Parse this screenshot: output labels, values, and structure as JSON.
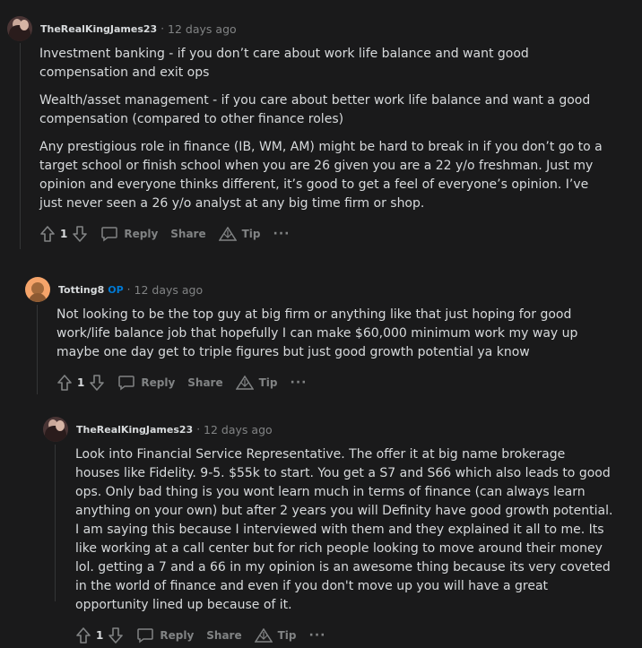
{
  "comments": [
    {
      "username": "TheRealKingJames23",
      "op_badge": "",
      "time": "12 days ago",
      "paragraphs": [
        "Investment banking - if you don’t care about work life balance and want good compensation and exit ops",
        "Wealth/asset management - if you care about better work life balance and want a good compensation (compared to other finance roles)",
        "Any prestigious role in finance (IB, WM, AM) might be hard to break in if you don’t go to a target school or finish school when you are 26 given you are a 22 y/o freshman. Just my opinion and everyone thinks different, it’s good to get a feel of everyone’s opinion. I’ve just never seen a 26 y/o analyst at any big time firm or shop."
      ],
      "votes": "1"
    },
    {
      "username": "Totting8",
      "op_badge": "OP",
      "time": "12 days ago",
      "paragraphs": [
        "Not looking to be the top guy at big firm or anything like that just hoping for good work/life balance job that hopefully I can make $60,000 minimum work my way up maybe one day get to triple figures but just good growth potential ya know"
      ],
      "votes": "1"
    },
    {
      "username": "TheRealKingJames23",
      "op_badge": "",
      "time": "12 days ago",
      "paragraphs": [
        "Look into Financial Service Representative. The offer it at big name brokerage houses like Fidelity. 9-5. $55k to start. You get a S7 and S66 which also leads to good ops. Only bad thing is you wont learn much in terms of finance (can always learn anything on your own) but after 2 years you will Definity have good growth potential. I am saying this because I interviewed with them and they explained it all to me. Its like working at a call center but for rich people looking to move around their money lol. getting a 7 and a 66 in my opinion is an awesome thing because its very coveted in the world of finance and even if you don't move up you will have a great opportunity lined up because of it."
      ],
      "votes": "1"
    }
  ],
  "labels": {
    "separator": "·",
    "reply": "Reply",
    "share": "Share",
    "tip": "Tip",
    "more": "···"
  },
  "icons": {
    "upvote": "upvote-arrow-icon",
    "downvote": "downvote-arrow-icon",
    "reply": "speech-bubble-icon",
    "tip": "tip-triangle-icon",
    "more": "ellipsis-icon"
  },
  "colors": {
    "background": "#1a1a1b",
    "text": "#d7dadc",
    "muted": "#818384",
    "op": "#0079d3",
    "thread_line": "#343536"
  }
}
